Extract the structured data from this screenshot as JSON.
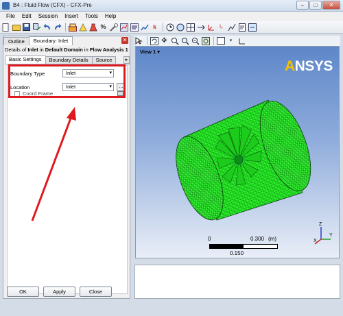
{
  "window": {
    "title": "B4 : Fluid Flow (CFX) - CFX-Pre",
    "minimize": "–",
    "maximize": "□",
    "close": "✕"
  },
  "menu": [
    "File",
    "Edit",
    "Session",
    "Insert",
    "Tools",
    "Help"
  ],
  "panel": {
    "tabs": [
      "Outline",
      "Boundary: Inlet"
    ],
    "close_glyph": "✕",
    "details_prefix": "Details of ",
    "details_name": "Inlet",
    "details_mid": " in ",
    "details_domain": "Default Domain",
    "details_mid2": " in ",
    "details_analysis": "Flow Analysis 1",
    "sub_tabs": [
      "Basic Settings",
      "Boundary Details",
      "Source"
    ],
    "sub_arrow": "▸",
    "boundary_type_label": "Boundary Type",
    "boundary_type_value": "Inlet",
    "location_label": "Location",
    "location_value": "Inlet",
    "browse_label": "...",
    "coord_frame_label": "Coord Frame"
  },
  "buttons": {
    "ok": "OK",
    "apply": "Apply",
    "close": "Close"
  },
  "viewer": {
    "view_label": "View 1",
    "logo": "ANSYS",
    "scale": {
      "zero": "0",
      "mid": "0.150",
      "max": "0.300",
      "unit": "(m)"
    },
    "axes": {
      "x": "X",
      "y": "Y",
      "z": "Z"
    }
  },
  "colors": {
    "highlight": "#e0191e",
    "mesh": "#22dd22",
    "arrow": "#e0191e"
  }
}
